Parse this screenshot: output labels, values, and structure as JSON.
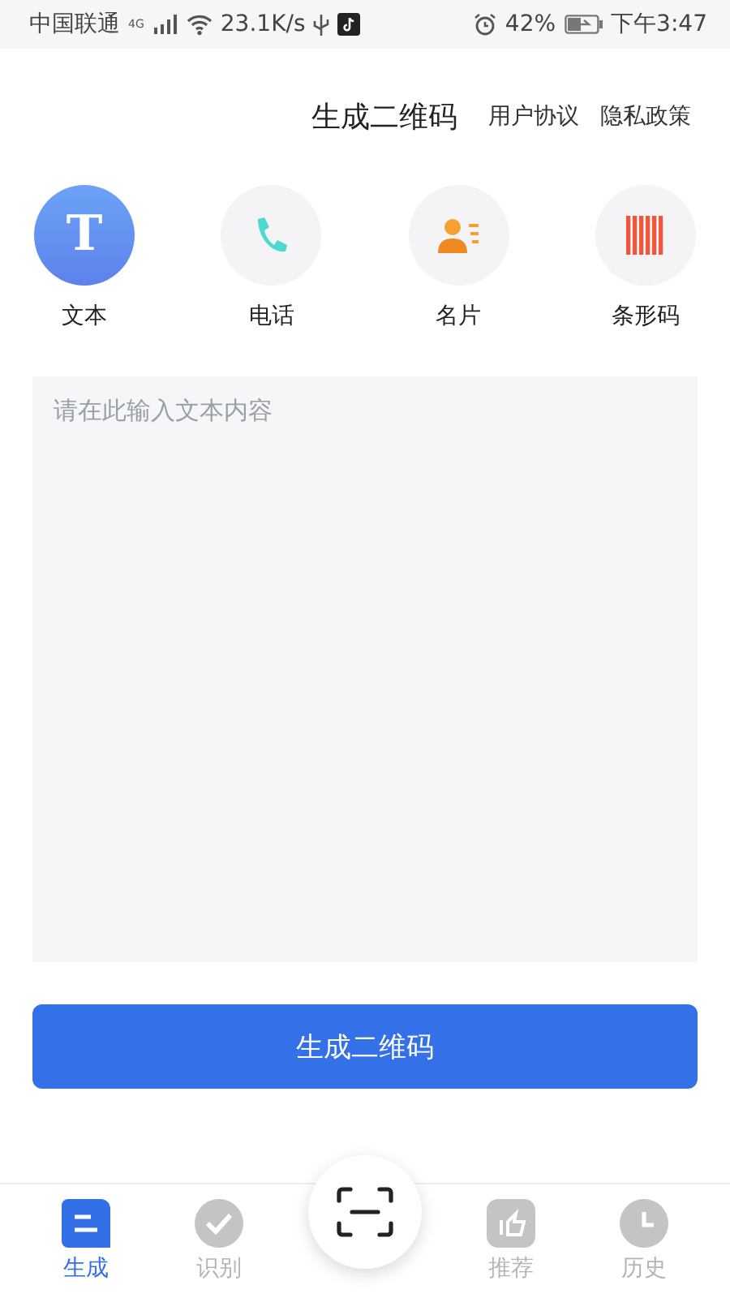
{
  "status_bar": {
    "carrier": "中国联通",
    "network": "4G",
    "speed": "23.1K/s",
    "battery": "42%",
    "time": "下午3:47"
  },
  "header": {
    "title": "生成二维码",
    "links": [
      "用户协议",
      "隐私政策"
    ]
  },
  "types": [
    {
      "kind": "text",
      "label": "文本",
      "glyph": "T",
      "selected": true
    },
    {
      "kind": "phone",
      "label": "电话",
      "selected": false
    },
    {
      "kind": "card",
      "label": "名片",
      "selected": false
    },
    {
      "kind": "barcode",
      "label": "条形码",
      "selected": false
    }
  ],
  "input": {
    "placeholder": "请在此输入文本内容"
  },
  "generate_button": "生成二维码",
  "tabs": [
    {
      "kind": "generate",
      "label": "生成",
      "selected": true
    },
    {
      "kind": "scan_result",
      "label": "识别",
      "selected": false
    },
    {
      "kind": "scan"
    },
    {
      "kind": "recommend",
      "label": "推荐",
      "selected": false
    },
    {
      "kind": "history",
      "label": "历史",
      "selected": false
    }
  ]
}
